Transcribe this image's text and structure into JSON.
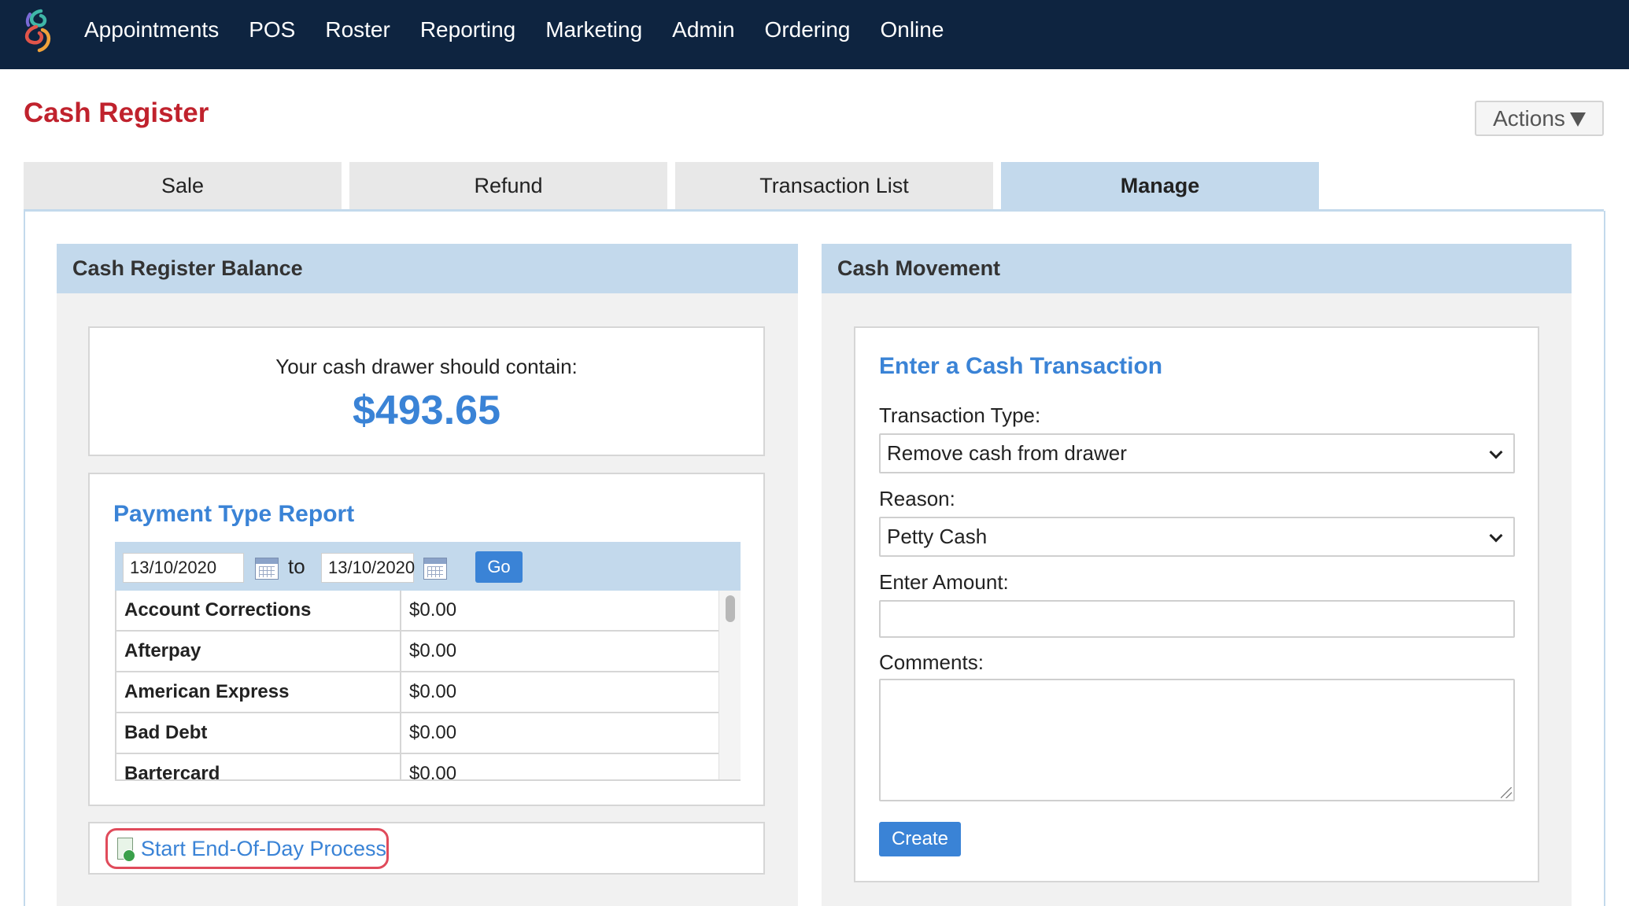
{
  "nav": {
    "logo_icon": "swirl-logo-icon",
    "items": [
      "Appointments",
      "POS",
      "Roster",
      "Reporting",
      "Marketing",
      "Admin",
      "Ordering",
      "Online"
    ]
  },
  "header": {
    "title": "Cash Register",
    "actions_label": "Actions"
  },
  "tabs": [
    {
      "label": "Sale",
      "active": false
    },
    {
      "label": "Refund",
      "active": false
    },
    {
      "label": "Transaction List",
      "active": false
    },
    {
      "label": "Manage",
      "active": true
    }
  ],
  "balance_panel": {
    "header": "Cash Register Balance",
    "drawer_label": "Your cash drawer should contain:",
    "amount": "$493.65"
  },
  "payment_report": {
    "title": "Payment Type Report",
    "date_from": "13/10/2020",
    "to_label": "to",
    "date_to": "13/10/2020",
    "go_label": "Go",
    "rows": [
      {
        "name": "Account Corrections",
        "value": "$0.00"
      },
      {
        "name": "Afterpay",
        "value": "$0.00"
      },
      {
        "name": "American Express",
        "value": "$0.00"
      },
      {
        "name": "Bad Debt",
        "value": "$0.00"
      },
      {
        "name": "Bartercard",
        "value": "$0.00"
      }
    ]
  },
  "end_of_day": {
    "label": "Start End-Of-Day Process"
  },
  "cash_movement": {
    "header": "Cash Movement",
    "title": "Enter a Cash Transaction",
    "transaction_type_label": "Transaction Type:",
    "transaction_type_value": "Remove cash from drawer",
    "reason_label": "Reason:",
    "reason_value": "Petty Cash",
    "amount_label": "Enter Amount:",
    "amount_value": "",
    "comments_label": "Comments:",
    "comments_value": "",
    "create_label": "Create"
  },
  "colors": {
    "nav_bg": "#0e2440",
    "title_red": "#c0222d",
    "accent_blue": "#3a83d6",
    "panel_header_bg": "#c3d9ec",
    "highlight_red": "#e04b5b"
  }
}
